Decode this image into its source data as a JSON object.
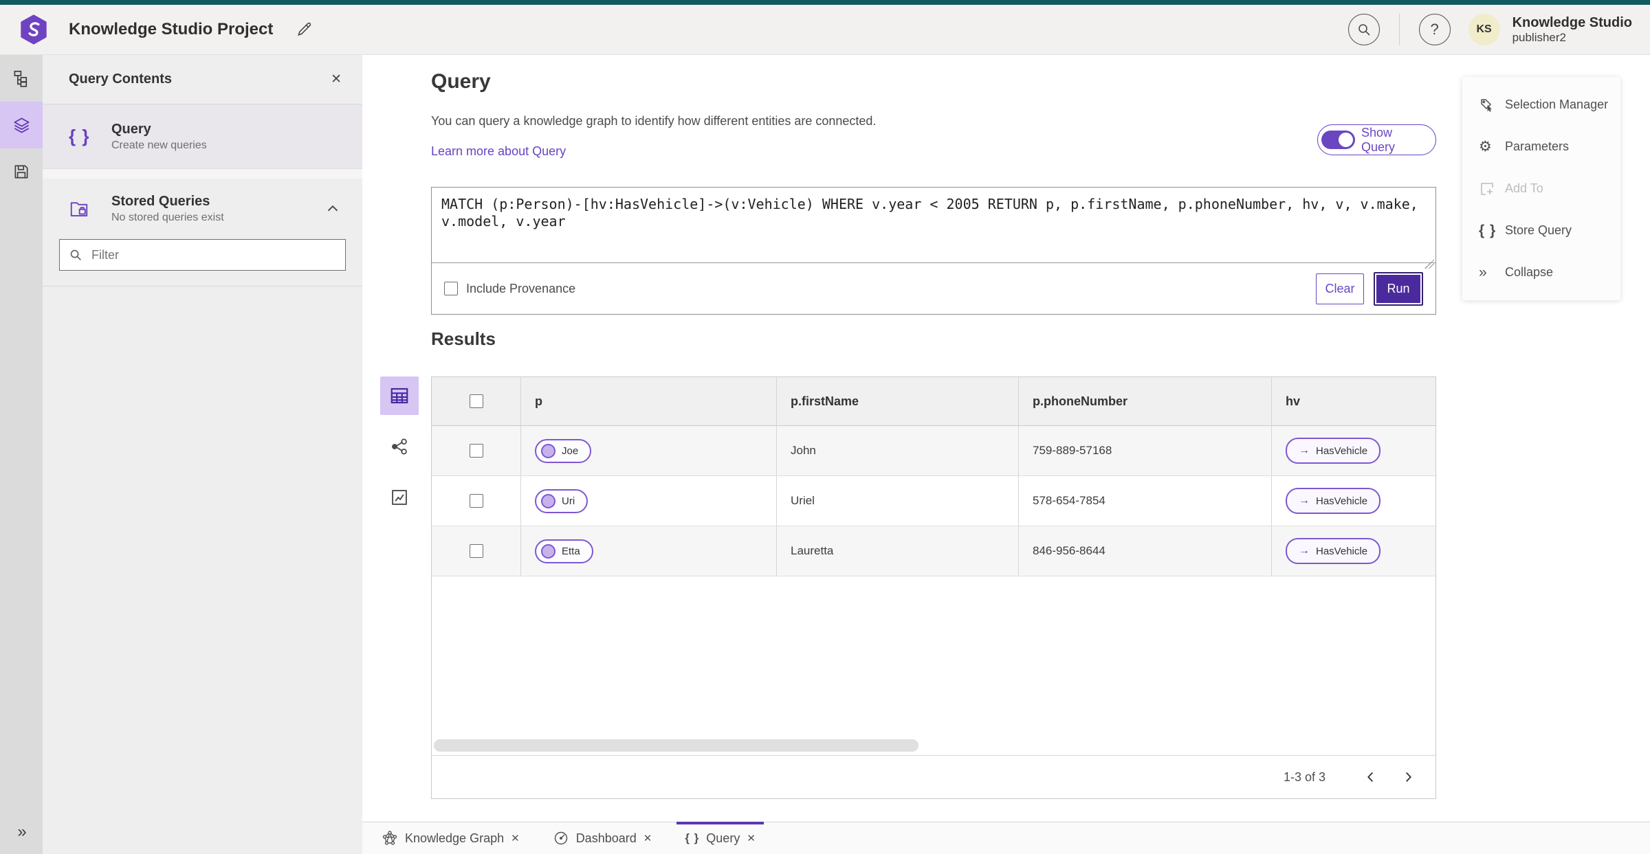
{
  "header": {
    "title": "Knowledge Studio Project",
    "account": {
      "initials": "KS",
      "name": "Knowledge Studio",
      "user": "publisher2"
    }
  },
  "icons": {
    "close": "✕",
    "help": "?",
    "braces": "{ }",
    "gear": "⚙",
    "collapse": "»",
    "arrow_right": "→"
  },
  "panel": {
    "title": "Query Contents",
    "query_item": {
      "label": "Query",
      "sublabel": "Create new queries"
    },
    "stored_item": {
      "label": "Stored Queries",
      "sublabel": "No stored queries exist"
    },
    "filter_placeholder": "Filter"
  },
  "query_section": {
    "heading": "Query",
    "description": "You can query a knowledge graph to identify how different entities are connected.",
    "learn_more_label": "Learn more about Query",
    "show_query_label": "Show Query",
    "query_text": "MATCH (p:Person)-[hv:HasVehicle]->(v:Vehicle) WHERE v.year < 2005 RETURN p, p.firstName, p.phoneNumber, hv, v, v.make, v.model, v.year",
    "include_provenance_label": "Include Provenance",
    "clear_label": "Clear",
    "run_label": "Run"
  },
  "results": {
    "heading": "Results",
    "columns": [
      "p",
      "p.firstName",
      "p.phoneNumber",
      "hv"
    ],
    "rows": [
      {
        "p": "Joe",
        "firstName": "John",
        "phoneNumber": "759-889-57168",
        "hv": "HasVehicle"
      },
      {
        "p": "Uri",
        "firstName": "Uriel",
        "phoneNumber": "578-654-7854",
        "hv": "HasVehicle"
      },
      {
        "p": "Etta",
        "firstName": "Lauretta",
        "phoneNumber": "846-956-8644",
        "hv": "HasVehicle"
      }
    ],
    "pagination_label": "1-3 of 3"
  },
  "context_menu": {
    "items": [
      {
        "label": "Selection Manager"
      },
      {
        "label": "Parameters"
      },
      {
        "label": "Add To"
      },
      {
        "label": "Store Query"
      },
      {
        "label": "Collapse"
      }
    ]
  },
  "tabs": [
    {
      "label": "Knowledge Graph"
    },
    {
      "label": "Dashboard"
    },
    {
      "label": "Query"
    }
  ],
  "colors": {
    "accent": "#6a46c1",
    "accent_dark": "#4b2a9d",
    "top_stripe": "#135a60",
    "selection_bg": "#d7c5f4"
  }
}
